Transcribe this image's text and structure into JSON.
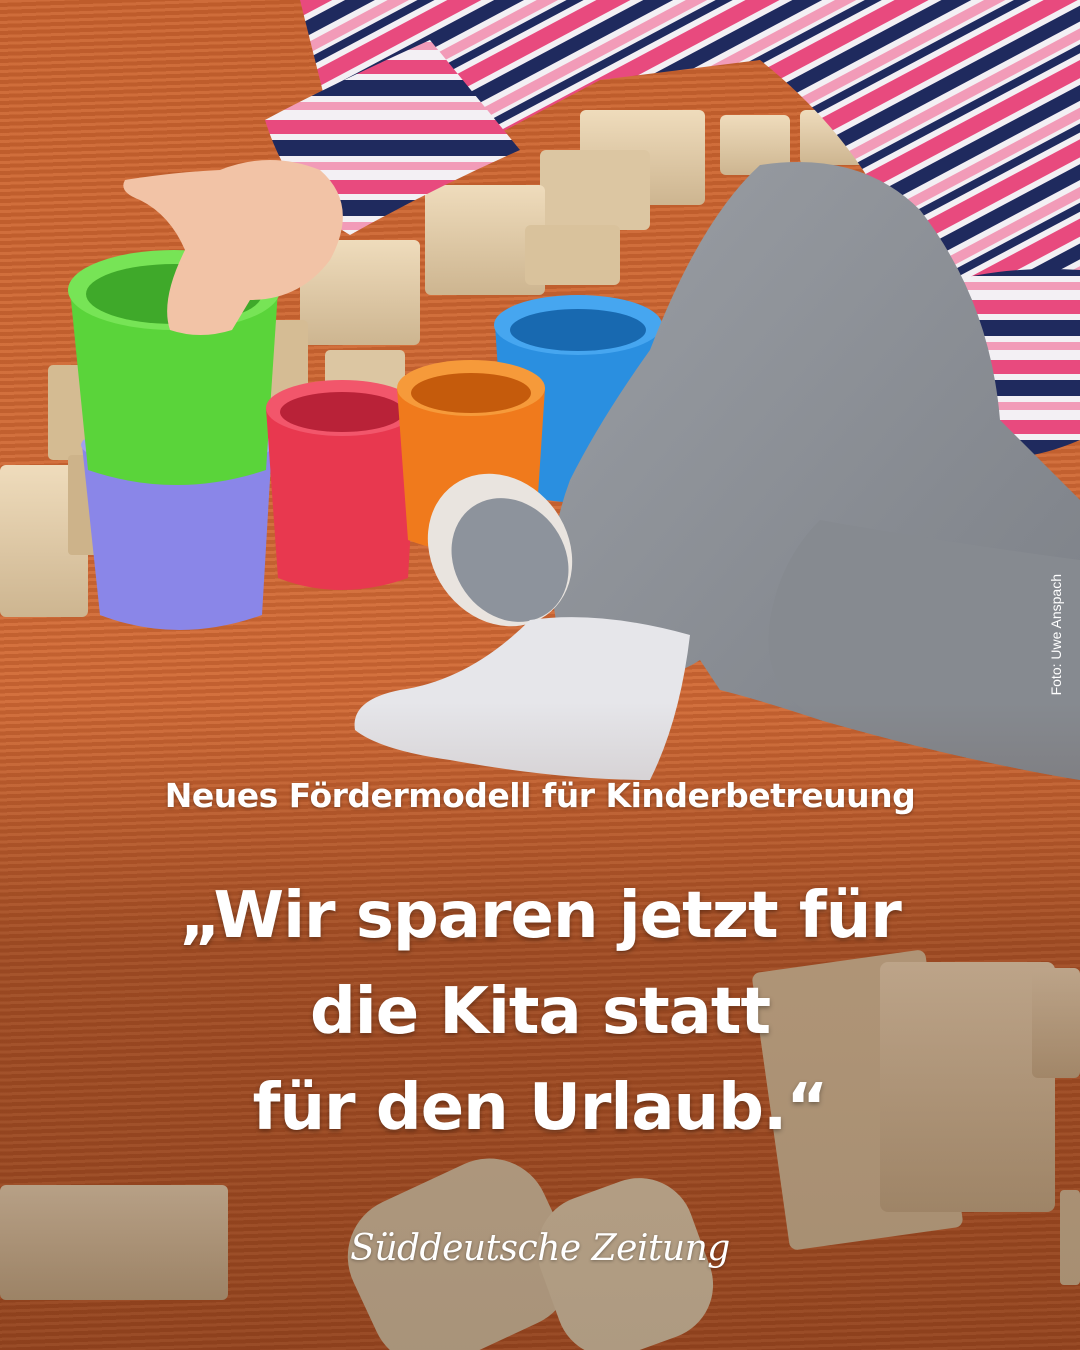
{
  "photo": {
    "subject": "child-playing-with-stacking-cups-and-wooden-blocks",
    "colors": {
      "carpet": "#c9632f",
      "cup_green": "#5ad43a",
      "cup_purple": "#8a86e8",
      "cup_red": "#e8384f",
      "cup_orange": "#f07a1c",
      "cup_blue": "#2a8fe0",
      "wood": "#e3cfae",
      "pants": "#8b8f95",
      "sock": "#e6e6ea"
    }
  },
  "photo_credit": "Foto: Uwe Anspach",
  "kicker": "Neues Fördermodell für Kinderbetreuung",
  "headline": {
    "lines": [
      "„Wir sparen jetzt für",
      "die Kita statt",
      "für den Urlaub.“"
    ]
  },
  "brand": {
    "name": "Süddeutsche Zeitung",
    "text_color": "#ffffff"
  }
}
